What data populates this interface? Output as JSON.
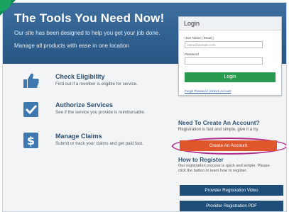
{
  "hero": {
    "title": "The Tools You Need Now!",
    "line1": "Our site has been designed to help you get your job done.",
    "line2": "Manage all products with ease in one location"
  },
  "features": [
    {
      "title": "Check Eligibility",
      "desc": "Find out if a member is eligible for service.",
      "icon": "thumbs-up-icon"
    },
    {
      "title": "Authorize Services",
      "desc": "See if the service you provide is reimbursable.",
      "icon": "checkmark-icon"
    },
    {
      "title": "Manage Claims",
      "desc": "Submit or track your claims and get paid fast.",
      "icon": "dollar-icon"
    }
  ],
  "login": {
    "title": "Login",
    "username_label": "User Name ( Email )",
    "username_placeholder": "name@domain.com",
    "password_label": "Password",
    "password_value": "",
    "button": "Login",
    "forgot": "Forgot Password | Unlock Account"
  },
  "register": {
    "heading": "Need To Create An Account?",
    "subtext": "Registration is fast and simple, give it a try.",
    "create_button": "Create An Account",
    "how_heading": "How to Register",
    "how_text": "Our registration process is quick and simple. Please click the button to learn how to register.",
    "video_button": "Provider Registration Video",
    "pdf_button": "Provider Registration PDF"
  },
  "colors": {
    "hero_bg": "#2f5f8e",
    "login_green": "#2a9a4e",
    "create_orange": "#e0562c",
    "highlight_ring": "#b12a8c",
    "navy_button": "#1f4e79"
  }
}
